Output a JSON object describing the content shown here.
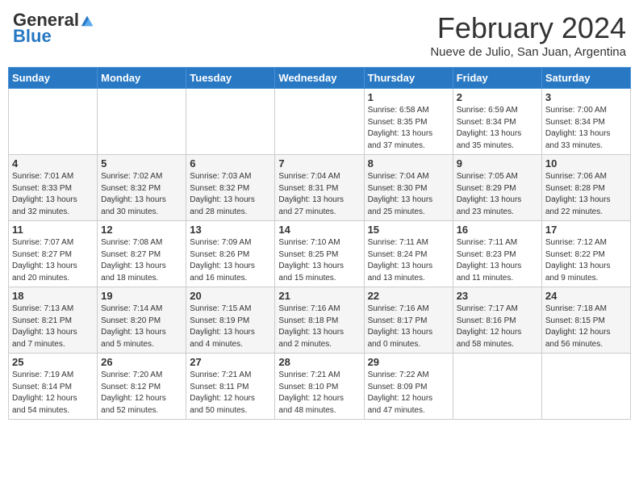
{
  "header": {
    "logo_general": "General",
    "logo_blue": "Blue",
    "month_title": "February 2024",
    "subtitle": "Nueve de Julio, San Juan, Argentina"
  },
  "days_of_week": [
    "Sunday",
    "Monday",
    "Tuesday",
    "Wednesday",
    "Thursday",
    "Friday",
    "Saturday"
  ],
  "weeks": [
    [
      {
        "day": "",
        "info": ""
      },
      {
        "day": "",
        "info": ""
      },
      {
        "day": "",
        "info": ""
      },
      {
        "day": "",
        "info": ""
      },
      {
        "day": "1",
        "info": "Sunrise: 6:58 AM\nSunset: 8:35 PM\nDaylight: 13 hours\nand 37 minutes."
      },
      {
        "day": "2",
        "info": "Sunrise: 6:59 AM\nSunset: 8:34 PM\nDaylight: 13 hours\nand 35 minutes."
      },
      {
        "day": "3",
        "info": "Sunrise: 7:00 AM\nSunset: 8:34 PM\nDaylight: 13 hours\nand 33 minutes."
      }
    ],
    [
      {
        "day": "4",
        "info": "Sunrise: 7:01 AM\nSunset: 8:33 PM\nDaylight: 13 hours\nand 32 minutes."
      },
      {
        "day": "5",
        "info": "Sunrise: 7:02 AM\nSunset: 8:32 PM\nDaylight: 13 hours\nand 30 minutes."
      },
      {
        "day": "6",
        "info": "Sunrise: 7:03 AM\nSunset: 8:32 PM\nDaylight: 13 hours\nand 28 minutes."
      },
      {
        "day": "7",
        "info": "Sunrise: 7:04 AM\nSunset: 8:31 PM\nDaylight: 13 hours\nand 27 minutes."
      },
      {
        "day": "8",
        "info": "Sunrise: 7:04 AM\nSunset: 8:30 PM\nDaylight: 13 hours\nand 25 minutes."
      },
      {
        "day": "9",
        "info": "Sunrise: 7:05 AM\nSunset: 8:29 PM\nDaylight: 13 hours\nand 23 minutes."
      },
      {
        "day": "10",
        "info": "Sunrise: 7:06 AM\nSunset: 8:28 PM\nDaylight: 13 hours\nand 22 minutes."
      }
    ],
    [
      {
        "day": "11",
        "info": "Sunrise: 7:07 AM\nSunset: 8:27 PM\nDaylight: 13 hours\nand 20 minutes."
      },
      {
        "day": "12",
        "info": "Sunrise: 7:08 AM\nSunset: 8:27 PM\nDaylight: 13 hours\nand 18 minutes."
      },
      {
        "day": "13",
        "info": "Sunrise: 7:09 AM\nSunset: 8:26 PM\nDaylight: 13 hours\nand 16 minutes."
      },
      {
        "day": "14",
        "info": "Sunrise: 7:10 AM\nSunset: 8:25 PM\nDaylight: 13 hours\nand 15 minutes."
      },
      {
        "day": "15",
        "info": "Sunrise: 7:11 AM\nSunset: 8:24 PM\nDaylight: 13 hours\nand 13 minutes."
      },
      {
        "day": "16",
        "info": "Sunrise: 7:11 AM\nSunset: 8:23 PM\nDaylight: 13 hours\nand 11 minutes."
      },
      {
        "day": "17",
        "info": "Sunrise: 7:12 AM\nSunset: 8:22 PM\nDaylight: 13 hours\nand 9 minutes."
      }
    ],
    [
      {
        "day": "18",
        "info": "Sunrise: 7:13 AM\nSunset: 8:21 PM\nDaylight: 13 hours\nand 7 minutes."
      },
      {
        "day": "19",
        "info": "Sunrise: 7:14 AM\nSunset: 8:20 PM\nDaylight: 13 hours\nand 5 minutes."
      },
      {
        "day": "20",
        "info": "Sunrise: 7:15 AM\nSunset: 8:19 PM\nDaylight: 13 hours\nand 4 minutes."
      },
      {
        "day": "21",
        "info": "Sunrise: 7:16 AM\nSunset: 8:18 PM\nDaylight: 13 hours\nand 2 minutes."
      },
      {
        "day": "22",
        "info": "Sunrise: 7:16 AM\nSunset: 8:17 PM\nDaylight: 13 hours\nand 0 minutes."
      },
      {
        "day": "23",
        "info": "Sunrise: 7:17 AM\nSunset: 8:16 PM\nDaylight: 12 hours\nand 58 minutes."
      },
      {
        "day": "24",
        "info": "Sunrise: 7:18 AM\nSunset: 8:15 PM\nDaylight: 12 hours\nand 56 minutes."
      }
    ],
    [
      {
        "day": "25",
        "info": "Sunrise: 7:19 AM\nSunset: 8:14 PM\nDaylight: 12 hours\nand 54 minutes."
      },
      {
        "day": "26",
        "info": "Sunrise: 7:20 AM\nSunset: 8:12 PM\nDaylight: 12 hours\nand 52 minutes."
      },
      {
        "day": "27",
        "info": "Sunrise: 7:21 AM\nSunset: 8:11 PM\nDaylight: 12 hours\nand 50 minutes."
      },
      {
        "day": "28",
        "info": "Sunrise: 7:21 AM\nSunset: 8:10 PM\nDaylight: 12 hours\nand 48 minutes."
      },
      {
        "day": "29",
        "info": "Sunrise: 7:22 AM\nSunset: 8:09 PM\nDaylight: 12 hours\nand 47 minutes."
      },
      {
        "day": "",
        "info": ""
      },
      {
        "day": "",
        "info": ""
      }
    ]
  ]
}
